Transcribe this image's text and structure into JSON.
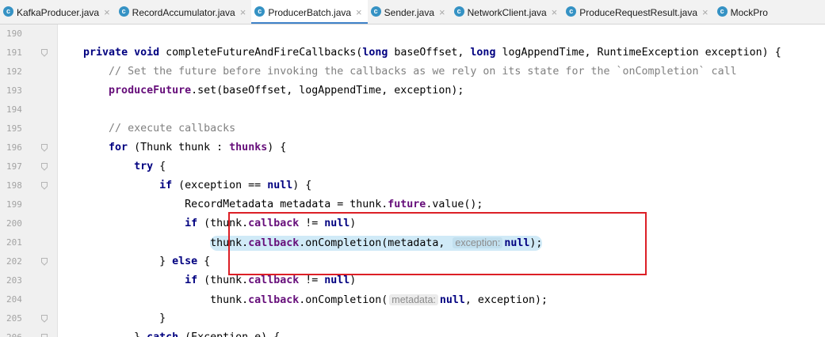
{
  "editor_tabs": [
    {
      "label": "KafkaProducer.java",
      "icon": "class-icon",
      "icon_glyph": "c"
    },
    {
      "label": "RecordAccumulator.java",
      "icon": "class-icon",
      "icon_glyph": "c"
    },
    {
      "label": "ProducerBatch.java",
      "icon": "class-icon",
      "icon_glyph": "c",
      "active": true
    },
    {
      "label": "Sender.java",
      "icon": "class-icon",
      "icon_glyph": "c"
    },
    {
      "label": "NetworkClient.java",
      "icon": "class-icon",
      "icon_glyph": "c"
    },
    {
      "label": "ProduceRequestResult.java",
      "icon": "class-icon",
      "icon_glyph": "c"
    },
    {
      "label": "MockPro",
      "icon": "class-icon",
      "icon_glyph": "c"
    }
  ],
  "tab_close_glyph": "×",
  "colors": {
    "keyword": "#000080",
    "field": "#660e7a",
    "comment": "#808080",
    "highlight_box": "#dc1f26",
    "active_tab_underline": "#4083c9",
    "execution_line_bg": "#d0eaf7"
  },
  "code_lines": [
    {
      "num": "190",
      "fold": false,
      "tokens": []
    },
    {
      "num": "191",
      "fold": true,
      "tokens": [
        {
          "t": "    "
        },
        {
          "t": "private",
          "c": "kw"
        },
        {
          "t": " "
        },
        {
          "t": "void",
          "c": "kw"
        },
        {
          "t": " completeFutureAndFireCallbacks("
        },
        {
          "t": "long",
          "c": "kw"
        },
        {
          "t": " baseOffset, "
        },
        {
          "t": "long",
          "c": "kw"
        },
        {
          "t": " logAppendTime, RuntimeException exception) {"
        }
      ]
    },
    {
      "num": "192",
      "fold": false,
      "tokens": [
        {
          "t": "        "
        },
        {
          "t": "// Set the future before invoking the callbacks as we rely on its state for the `onCompletion` call",
          "c": "cmt"
        }
      ]
    },
    {
      "num": "193",
      "fold": false,
      "tokens": [
        {
          "t": "        "
        },
        {
          "t": "produceFuture",
          "c": "fld"
        },
        {
          "t": ".set(baseOffset, logAppendTime, exception);"
        }
      ]
    },
    {
      "num": "194",
      "fold": false,
      "tokens": []
    },
    {
      "num": "195",
      "fold": false,
      "tokens": [
        {
          "t": "        "
        },
        {
          "t": "// execute callbacks",
          "c": "cmt"
        }
      ]
    },
    {
      "num": "196",
      "fold": true,
      "tokens": [
        {
          "t": "        "
        },
        {
          "t": "for",
          "c": "kw"
        },
        {
          "t": " (Thunk thunk : "
        },
        {
          "t": "thunks",
          "c": "fld"
        },
        {
          "t": ") {"
        }
      ]
    },
    {
      "num": "197",
      "fold": true,
      "tokens": [
        {
          "t": "            "
        },
        {
          "t": "try",
          "c": "kw"
        },
        {
          "t": " {"
        }
      ]
    },
    {
      "num": "198",
      "fold": true,
      "tokens": [
        {
          "t": "                "
        },
        {
          "t": "if",
          "c": "kw"
        },
        {
          "t": " (exception == "
        },
        {
          "t": "null",
          "c": "kw"
        },
        {
          "t": ") {"
        }
      ]
    },
    {
      "num": "199",
      "fold": false,
      "tokens": [
        {
          "t": "                    RecordMetadata metadata = thunk."
        },
        {
          "t": "future",
          "c": "fld"
        },
        {
          "t": ".value();"
        }
      ]
    },
    {
      "num": "200",
      "fold": false,
      "tokens": [
        {
          "t": "                    "
        },
        {
          "t": "if",
          "c": "kw"
        },
        {
          "t": " (thunk."
        },
        {
          "t": "callback",
          "c": "fld"
        },
        {
          "t": " != "
        },
        {
          "t": "null",
          "c": "kw"
        },
        {
          "t": ")"
        }
      ]
    },
    {
      "num": "201",
      "fold": false,
      "highlight": true,
      "tokens": [
        {
          "t": "                        "
        },
        {
          "g": "pill",
          "tokens": [
            {
              "t": "thunk."
            },
            {
              "t": "callback",
              "c": "fld"
            },
            {
              "t": ".onCompletion(metadata, "
            },
            {
              "t": "exception:",
              "c": "hint"
            },
            {
              "t": "null",
              "c": "kw"
            },
            {
              "t": ");"
            }
          ]
        }
      ]
    },
    {
      "num": "202",
      "fold": true,
      "tokens": [
        {
          "t": "                } "
        },
        {
          "t": "else",
          "c": "kw"
        },
        {
          "t": " {"
        }
      ]
    },
    {
      "num": "203",
      "fold": false,
      "tokens": [
        {
          "t": "                    "
        },
        {
          "t": "if",
          "c": "kw"
        },
        {
          "t": " (thunk."
        },
        {
          "t": "callback",
          "c": "fld"
        },
        {
          "t": " != "
        },
        {
          "t": "null",
          "c": "kw"
        },
        {
          "t": ")"
        }
      ]
    },
    {
      "num": "204",
      "fold": false,
      "tokens": [
        {
          "t": "                        thunk."
        },
        {
          "t": "callback",
          "c": "fld"
        },
        {
          "t": ".onCompletion("
        },
        {
          "t": "metadata:",
          "c": "hint"
        },
        {
          "t": "null",
          "c": "kw"
        },
        {
          "t": ", exception);"
        }
      ]
    },
    {
      "num": "205",
      "fold": true,
      "tokens": [
        {
          "t": "                }"
        }
      ]
    },
    {
      "num": "206",
      "fold": true,
      "tokens": [
        {
          "t": "            } "
        },
        {
          "t": "catch",
          "c": "kw"
        },
        {
          "t": " (Exception e) {"
        }
      ]
    }
  ]
}
